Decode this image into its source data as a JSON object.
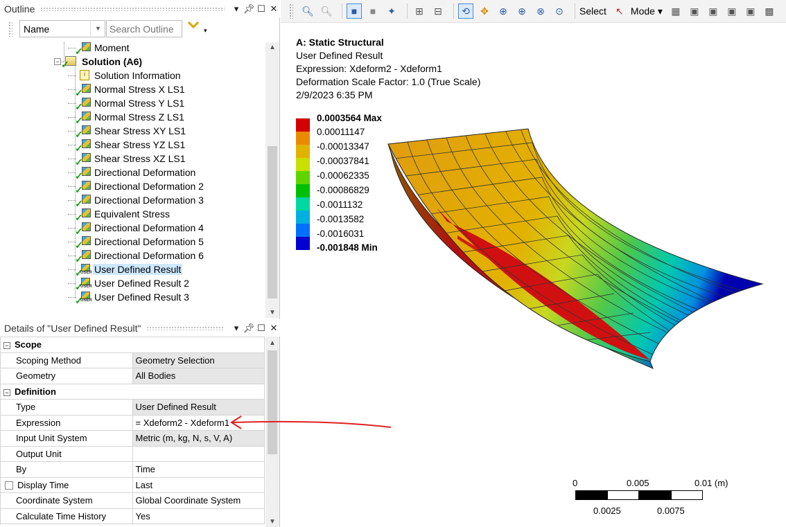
{
  "outline": {
    "title": "Outline",
    "name_combo": "Name",
    "search_placeholder": "Search Outline",
    "items": [
      {
        "label": "Moment",
        "icon": "moment-icon",
        "level": 2
      },
      {
        "label": "Solution (A6)",
        "icon": "solution-icon",
        "level": 1,
        "bold": true,
        "expanded": true
      },
      {
        "label": "Solution Information",
        "icon": "info-icon",
        "level": 2
      },
      {
        "label": "Normal Stress X LS1",
        "icon": "result-icon",
        "level": 2
      },
      {
        "label": "Normal Stress Y LS1",
        "icon": "result-icon",
        "level": 2
      },
      {
        "label": "Normal Stress Z LS1",
        "icon": "result-icon",
        "level": 2
      },
      {
        "label": "Shear Stress XY LS1",
        "icon": "result-icon",
        "level": 2
      },
      {
        "label": "Shear Stress YZ LS1",
        "icon": "result-icon",
        "level": 2
      },
      {
        "label": "Shear Stress XZ LS1",
        "icon": "result-icon",
        "level": 2
      },
      {
        "label": "Directional Deformation",
        "icon": "result-icon",
        "level": 2
      },
      {
        "label": "Directional Deformation 2",
        "icon": "result-icon",
        "level": 2
      },
      {
        "label": "Directional Deformation 3",
        "icon": "result-icon",
        "level": 2
      },
      {
        "label": "Equivalent Stress",
        "icon": "result-icon",
        "level": 2
      },
      {
        "label": "Directional Deformation 4",
        "icon": "result-icon",
        "level": 2
      },
      {
        "label": "Directional Deformation 5",
        "icon": "result-icon",
        "level": 2
      },
      {
        "label": "Directional Deformation 6",
        "icon": "result-icon",
        "level": 2
      },
      {
        "label": "User Defined Result",
        "icon": "user-result-icon",
        "level": 2,
        "selected": true
      },
      {
        "label": "User Defined Result 2",
        "icon": "user-result-icon",
        "level": 2
      },
      {
        "label": "User Defined Result 3",
        "icon": "user-result-icon",
        "level": 2
      }
    ]
  },
  "details": {
    "title": "Details of \"User Defined Result\"",
    "sections": [
      {
        "name": "Scope",
        "rows": [
          {
            "key": "Scoping Method",
            "value": "Geometry Selection",
            "readonly": true
          },
          {
            "key": "Geometry",
            "value": "All Bodies",
            "readonly": true
          }
        ]
      },
      {
        "name": "Definition",
        "rows": [
          {
            "key": "Type",
            "value": "User Defined Result",
            "readonly": true
          },
          {
            "key": "Expression",
            "value": "= Xdeform2 - Xdeform1",
            "readonly": false
          },
          {
            "key": "Input Unit System",
            "value": "Metric (m, kg, N, s, V, A)",
            "readonly": true
          },
          {
            "key": "Output Unit",
            "value": "",
            "readonly": false
          },
          {
            "key": "By",
            "value": "Time",
            "readonly": false
          },
          {
            "key": "Display Time",
            "value": "Last",
            "readonly": false,
            "checkbox": true
          },
          {
            "key": "Coordinate System",
            "value": "Global Coordinate System",
            "readonly": false
          },
          {
            "key": "Calculate Time History",
            "value": "Yes",
            "readonly": false
          }
        ]
      }
    ]
  },
  "toolbar": {
    "select_label": "Select",
    "mode_label": "Mode"
  },
  "viewport": {
    "title": "A: Static Structural",
    "subtitle": "User Defined Result",
    "expression": "Expression: Xdeform2 - Xdeform1",
    "scale_factor": "Deformation Scale Factor: 1.0 (True Scale)",
    "date": "2/9/2023 6:35 PM"
  },
  "legend": {
    "max_label": "0.0003564 Max",
    "min_label": "-0.001848 Min",
    "values": [
      "0.00011147",
      "-0.00013347",
      "-0.00037841",
      "-0.00062335",
      "-0.00086829",
      "-0.0011132",
      "-0.0013582",
      "-0.0016031"
    ],
    "colors": [
      "#d40000",
      "#e98a00",
      "#e2b200",
      "#c8e000",
      "#5fd400",
      "#00c000",
      "#00d8a0",
      "#00b0e0",
      "#0070ff",
      "#0000d0"
    ]
  },
  "scale": {
    "labels_top": [
      "0",
      "0.005",
      "0.01 (m)"
    ],
    "labels_bottom": [
      "0.0025",
      "0.0075"
    ]
  },
  "annotation": {
    "arrow_color": "#e02020"
  }
}
